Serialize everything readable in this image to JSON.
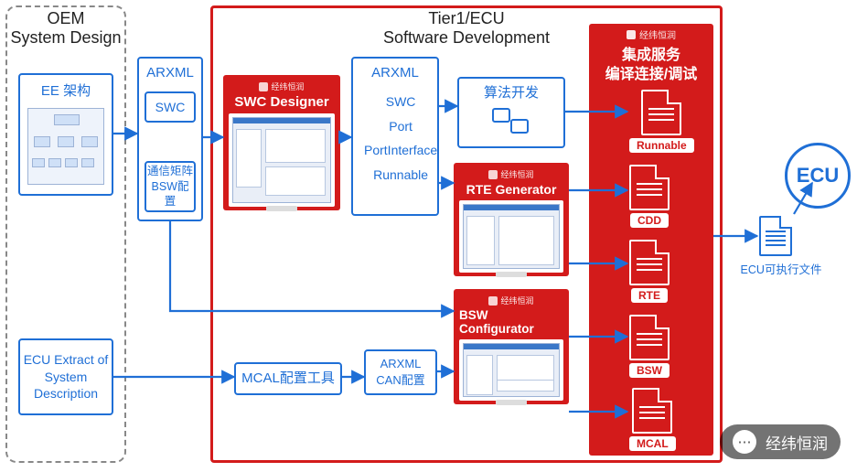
{
  "oem": {
    "title": "OEM\nSystem Design",
    "ee_label": "EE 架构",
    "ecu_extract": "ECU Extract of\nSystem\nDescription"
  },
  "arxml_left": {
    "title": "ARXML",
    "swc": "SWC",
    "comm": "通信矩阵\nBSW配置"
  },
  "tier1": {
    "title": "Tier1/ECU\nSoftware Development"
  },
  "tools": {
    "brand": "经纬恒润",
    "swc_designer": "SWC Designer",
    "rte_generator": "RTE Generator",
    "bsw_configurator": "BSW Configurator"
  },
  "arxml_mid": {
    "title": "ARXML",
    "items": [
      "SWC",
      "Port",
      "PortInterface",
      "Runnable"
    ]
  },
  "algo": {
    "label": "算法开发"
  },
  "mcal": {
    "tool": "MCAL配置工具",
    "out": "ARXML\nCAN配置"
  },
  "services": {
    "brand": "经纬恒润",
    "title": "集成服务\n编译连接/调试",
    "files": [
      "Runnable",
      "CDD",
      "RTE",
      "BSW",
      "MCAL"
    ]
  },
  "output": {
    "doc": "ECU可执行文件",
    "target": "ECU"
  },
  "watermark": "经纬恒润"
}
